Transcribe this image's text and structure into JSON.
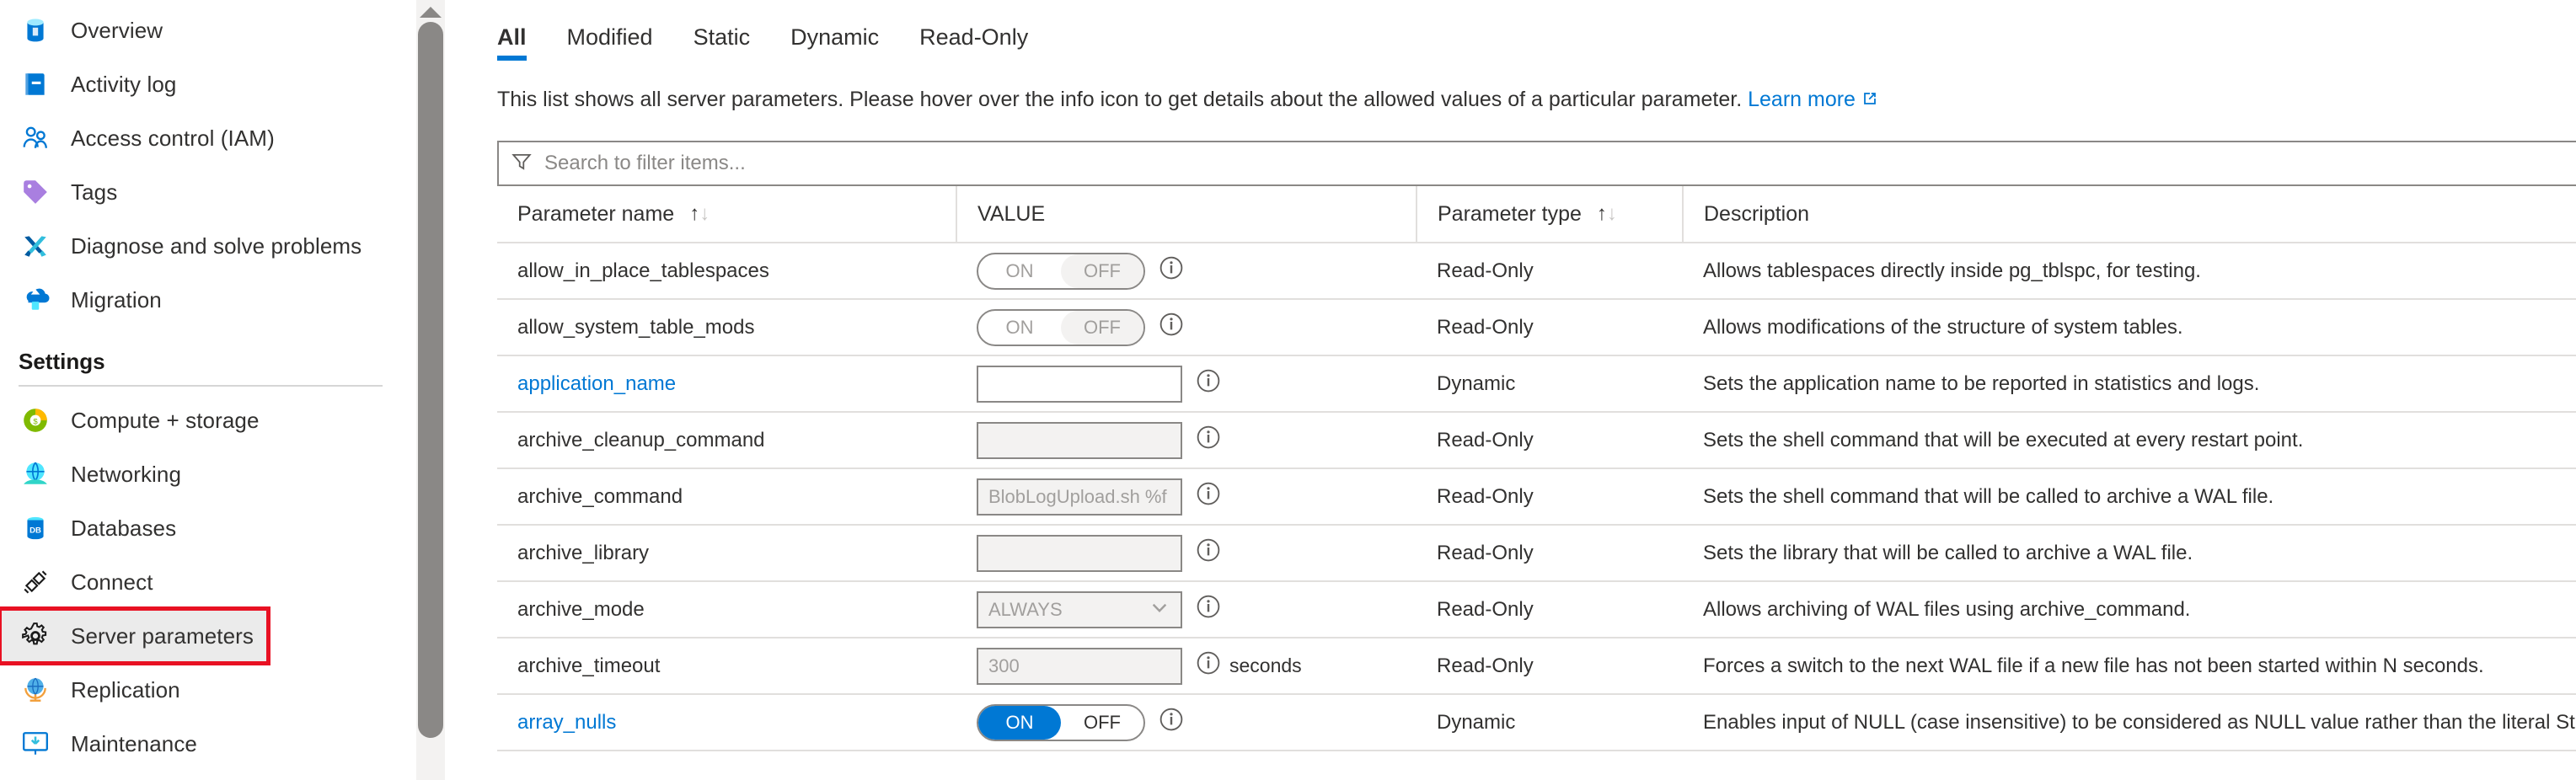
{
  "sidebar": {
    "items": [
      {
        "label": "Overview",
        "icon": "database-icon",
        "selected": false
      },
      {
        "label": "Activity log",
        "icon": "activity-log-icon",
        "selected": false
      },
      {
        "label": "Access control (IAM)",
        "icon": "access-control-icon",
        "selected": false
      },
      {
        "label": "Tags",
        "icon": "tag-icon",
        "selected": false
      },
      {
        "label": "Diagnose and solve problems",
        "icon": "wrench-screwdriver-icon",
        "selected": false
      },
      {
        "label": "Migration",
        "icon": "migration-icon",
        "selected": false
      }
    ],
    "section_title": "Settings",
    "settings_items": [
      {
        "label": "Compute + storage",
        "icon": "compute-storage-icon",
        "selected": false
      },
      {
        "label": "Networking",
        "icon": "networking-icon",
        "selected": false
      },
      {
        "label": "Databases",
        "icon": "databases-icon",
        "selected": false
      },
      {
        "label": "Connect",
        "icon": "connect-plug-icon",
        "selected": false
      },
      {
        "label": "Server parameters",
        "icon": "gear-icon",
        "selected": true
      },
      {
        "label": "Replication",
        "icon": "replication-globe-icon",
        "selected": false
      },
      {
        "label": "Maintenance",
        "icon": "maintenance-icon",
        "selected": false
      }
    ]
  },
  "main": {
    "tabs": [
      {
        "label": "All",
        "active": true
      },
      {
        "label": "Modified",
        "active": false
      },
      {
        "label": "Static",
        "active": false
      },
      {
        "label": "Dynamic",
        "active": false
      },
      {
        "label": "Read-Only",
        "active": false
      }
    ],
    "description": "This list shows all server parameters. Please hover over the info icon to get details about the allowed values of a particular parameter.",
    "learn_more_label": "Learn more",
    "search": {
      "placeholder": "Search to filter items...",
      "value": "",
      "icon": "filter-icon"
    },
    "table": {
      "columns": [
        {
          "label": "Parameter name",
          "sortable": true
        },
        {
          "label": "VALUE",
          "sortable": false
        },
        {
          "label": "Parameter type",
          "sortable": true
        },
        {
          "label": "Description",
          "sortable": false
        }
      ],
      "rows": [
        {
          "name": "allow_in_place_tablespaces",
          "name_is_link": false,
          "control": "toggle",
          "toggle_state": "off",
          "toggle_on_label": "ON",
          "toggle_off_label": "OFF",
          "unit": "",
          "type": "Read-Only",
          "description": "Allows tablespaces directly inside pg_tblspc, for testing."
        },
        {
          "name": "allow_system_table_mods",
          "name_is_link": false,
          "control": "toggle",
          "toggle_state": "off",
          "toggle_on_label": "ON",
          "toggle_off_label": "OFF",
          "unit": "",
          "type": "Read-Only",
          "description": "Allows modifications of the structure of system tables."
        },
        {
          "name": "application_name",
          "name_is_link": true,
          "control": "input",
          "value": "",
          "enabled": true,
          "unit": "",
          "type": "Dynamic",
          "description": "Sets the application name to be reported in statistics and logs."
        },
        {
          "name": "archive_cleanup_command",
          "name_is_link": false,
          "control": "input",
          "value": "",
          "enabled": false,
          "unit": "",
          "type": "Read-Only",
          "description": "Sets the shell command that will be executed at every restart point."
        },
        {
          "name": "archive_command",
          "name_is_link": false,
          "control": "input",
          "value": "BlobLogUpload.sh %f %p",
          "enabled": false,
          "unit": "",
          "type": "Read-Only",
          "description": "Sets the shell command that will be called to archive a WAL file."
        },
        {
          "name": "archive_library",
          "name_is_link": false,
          "control": "input",
          "value": "",
          "enabled": false,
          "unit": "",
          "type": "Read-Only",
          "description": "Sets the library that will be called to archive a WAL file."
        },
        {
          "name": "archive_mode",
          "name_is_link": false,
          "control": "select",
          "value": "ALWAYS",
          "enabled": false,
          "unit": "",
          "type": "Read-Only",
          "description": "Allows archiving of WAL files using archive_command."
        },
        {
          "name": "archive_timeout",
          "name_is_link": false,
          "control": "input",
          "value": "300",
          "enabled": false,
          "unit": "seconds",
          "type": "Read-Only",
          "description": "Forces a switch to the next WAL file if a new file has not been started within N seconds."
        },
        {
          "name": "array_nulls",
          "name_is_link": true,
          "control": "toggle",
          "toggle_state": "on",
          "toggle_on_label": "ON",
          "toggle_off_label": "OFF",
          "unit": "",
          "type": "Dynamic",
          "description": "Enables input of NULL (case insensitive) to be considered as NULL value rather than the literal String 'N..."
        }
      ]
    }
  },
  "colors": {
    "accent": "#0078d4",
    "annotation": "#e81123",
    "selected_bg": "#ebebeb",
    "border": "#8a8886",
    "row_divider": "#e1dfdd",
    "disabled_bg": "#f3f2f1",
    "disabled_text": "#a19f9d"
  }
}
